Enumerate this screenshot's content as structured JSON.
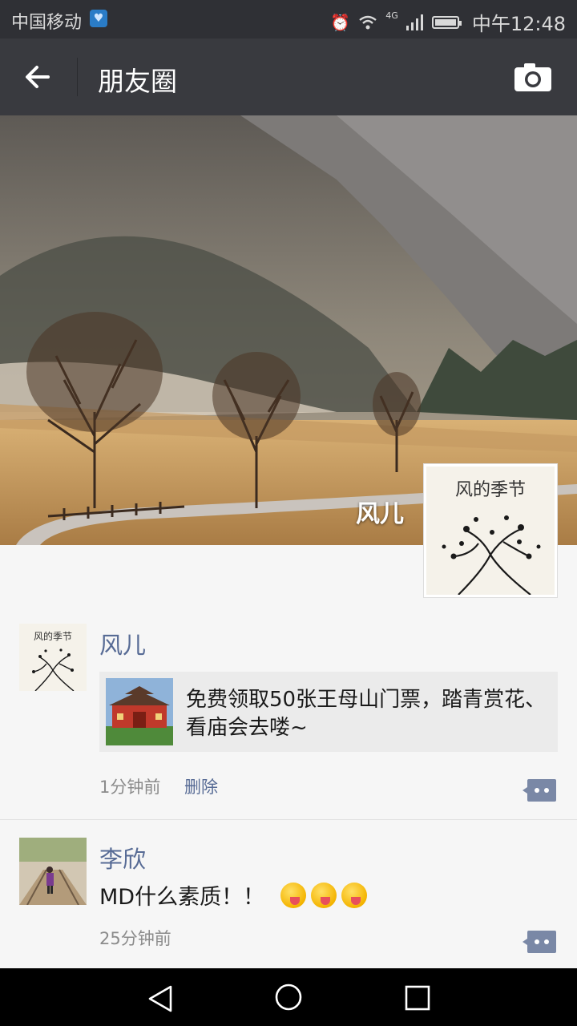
{
  "status_bar": {
    "carrier": "中国移动",
    "network": "4G",
    "time": "中午12:48"
  },
  "nav": {
    "title": "朋友圈"
  },
  "profile": {
    "name": "风儿",
    "avatar_caption": "风的季节"
  },
  "posts": [
    {
      "author": "风儿",
      "link_text": "免费领取50张王母山门票，踏青赏花、看庙会去喽~",
      "time_ago": "1分钟前",
      "delete_label": "删除"
    },
    {
      "author": "李欣",
      "text": "MD什么素质！！",
      "emoji_count": 3,
      "time_ago": "25分钟前"
    }
  ],
  "colors": {
    "nav_bg": "#393a3f",
    "status_bg": "#2f3035",
    "link_blue": "#576b95",
    "feed_bg": "#f6f6f6"
  }
}
